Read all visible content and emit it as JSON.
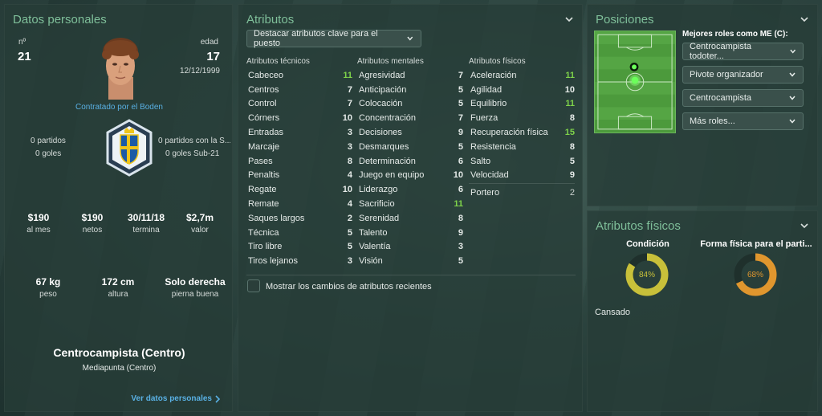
{
  "personal": {
    "title": "Datos personales",
    "number_label": "nº",
    "number": "21",
    "age_label": "edad",
    "age": "17",
    "birthdate": "12/12/1999",
    "contracted": "Contratado por el Boden",
    "matches": "0 partidos",
    "goals": "0 goles",
    "matches_u21": "0 partidos con la S...",
    "goals_u21": "0 goles Sub-21",
    "stats": [
      {
        "value": "$190",
        "label": "al mes"
      },
      {
        "value": "$190",
        "label": "netos"
      },
      {
        "value": "30/11/18",
        "label": "termina"
      },
      {
        "value": "$2,7m",
        "label": "valor"
      }
    ],
    "body": [
      {
        "value": "67 kg",
        "label": "peso"
      },
      {
        "value": "172 cm",
        "label": "altura"
      },
      {
        "value": "Solo derecha",
        "label": "pierna buena"
      }
    ],
    "position": "Centrocampista (Centro)",
    "secondary_position": "Mediapunta (Centro)",
    "more_link": "Ver datos personales",
    "colors": {
      "accent": "#59b0e3",
      "badge_blue": "#1b5aa6",
      "badge_yellow": "#f0c419"
    }
  },
  "attributes": {
    "title": "Atributos",
    "highlight_dropdown": "Destacar atributos clave para el puesto",
    "technical_header": "Atributos técnicos",
    "mental_header": "Atributos mentales",
    "physical_header": "Atributos físicos",
    "technical": [
      {
        "name": "Cabeceo",
        "value": "11",
        "hl": "green"
      },
      {
        "name": "Centros",
        "value": "7",
        "hl": ""
      },
      {
        "name": "Control",
        "value": "7",
        "hl": ""
      },
      {
        "name": "Córners",
        "value": "10",
        "hl": ""
      },
      {
        "name": "Entradas",
        "value": "3",
        "hl": ""
      },
      {
        "name": "Marcaje",
        "value": "3",
        "hl": ""
      },
      {
        "name": "Pases",
        "value": "8",
        "hl": ""
      },
      {
        "name": "Penaltis",
        "value": "4",
        "hl": ""
      },
      {
        "name": "Regate",
        "value": "10",
        "hl": ""
      },
      {
        "name": "Remate",
        "value": "4",
        "hl": ""
      },
      {
        "name": "Saques largos",
        "value": "2",
        "hl": ""
      },
      {
        "name": "Técnica",
        "value": "5",
        "hl": ""
      },
      {
        "name": "Tiro libre",
        "value": "5",
        "hl": ""
      },
      {
        "name": "Tiros lejanos",
        "value": "3",
        "hl": ""
      }
    ],
    "mental": [
      {
        "name": "Agresividad",
        "value": "7",
        "hl": ""
      },
      {
        "name": "Anticipación",
        "value": "5",
        "hl": ""
      },
      {
        "name": "Colocación",
        "value": "5",
        "hl": ""
      },
      {
        "name": "Concentración",
        "value": "7",
        "hl": ""
      },
      {
        "name": "Decisiones",
        "value": "9",
        "hl": ""
      },
      {
        "name": "Desmarques",
        "value": "5",
        "hl": ""
      },
      {
        "name": "Determinación",
        "value": "6",
        "hl": ""
      },
      {
        "name": "Juego en equipo",
        "value": "10",
        "hl": ""
      },
      {
        "name": "Liderazgo",
        "value": "6",
        "hl": ""
      },
      {
        "name": "Sacrificio",
        "value": "11",
        "hl": "green"
      },
      {
        "name": "Serenidad",
        "value": "8",
        "hl": ""
      },
      {
        "name": "Talento",
        "value": "9",
        "hl": ""
      },
      {
        "name": "Valentía",
        "value": "3",
        "hl": ""
      },
      {
        "name": "Visión",
        "value": "5",
        "hl": ""
      }
    ],
    "physical": [
      {
        "name": "Aceleración",
        "value": "11",
        "hl": "green"
      },
      {
        "name": "Agilidad",
        "value": "10",
        "hl": ""
      },
      {
        "name": "Equilibrio",
        "value": "11",
        "hl": "green"
      },
      {
        "name": "Fuerza",
        "value": "8",
        "hl": ""
      },
      {
        "name": "Recuperación física",
        "value": "15",
        "hl": "green"
      },
      {
        "name": "Resistencia",
        "value": "8",
        "hl": ""
      },
      {
        "name": "Salto",
        "value": "5",
        "hl": ""
      },
      {
        "name": "Velocidad",
        "value": "9",
        "hl": ""
      }
    ],
    "goalkeeper": {
      "name": "Portero",
      "value": "2"
    },
    "recent_changes_label": "Mostrar los cambios de atributos recientes",
    "colors": {
      "highlight": "#7ed24a"
    }
  },
  "positions": {
    "title": "Posiciones",
    "best_roles_label": "Mejores roles como ME (C):",
    "roles": [
      "Centrocampista todoter...",
      "Pivote organizador",
      "Centrocampista",
      "Más roles..."
    ],
    "colors": {
      "pitch": "#4c9a3c",
      "marker_green": "#6bff5a"
    }
  },
  "physical": {
    "title": "Atributos físicos",
    "condition_label": "Condición",
    "condition_text": "84%",
    "condition_value": 0.84,
    "match_fitness_label": "Forma física para el parti...",
    "match_fitness_text": "68%",
    "match_fitness_value": 0.68,
    "status": "Cansado",
    "colors": {
      "condition": "#c8c03a",
      "fitness": "#e0962e"
    }
  }
}
